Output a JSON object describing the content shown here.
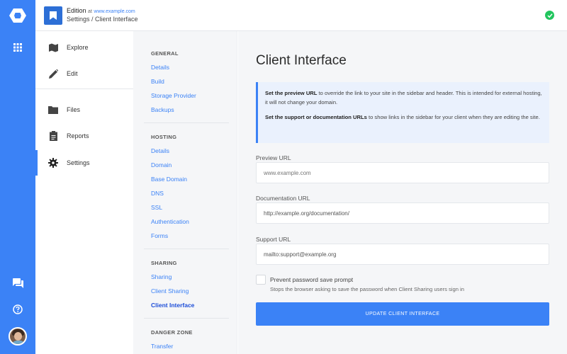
{
  "header": {
    "site_name": "Edition",
    "at_label": "at",
    "site_url": "www.example.com",
    "breadcrumb": "Settings / Client Interface",
    "status_icon": "check-circle-icon",
    "status_color": "#22c55e"
  },
  "rail": {
    "brand_color": "#3b82f6",
    "icons": [
      "logo-icon",
      "apps-grid-icon",
      "chat-icon",
      "help-icon",
      "avatar"
    ]
  },
  "nav": {
    "items": [
      {
        "label": "Explore",
        "icon": "map-icon"
      },
      {
        "label": "Edit",
        "icon": "pencil-icon"
      },
      {
        "label": "Files",
        "icon": "folder-icon"
      },
      {
        "label": "Reports",
        "icon": "clipboard-icon"
      },
      {
        "label": "Settings",
        "icon": "gear-icon",
        "active": true
      }
    ]
  },
  "subnav": {
    "sections": [
      {
        "heading": "GENERAL",
        "links": [
          "Details",
          "Build",
          "Storage Provider",
          "Backups"
        ]
      },
      {
        "heading": "HOSTING",
        "links": [
          "Details",
          "Domain",
          "Base Domain",
          "DNS",
          "SSL",
          "Authentication",
          "Forms"
        ]
      },
      {
        "heading": "SHARING",
        "links": [
          "Sharing",
          "Client Sharing",
          "Client Interface"
        ]
      },
      {
        "heading": "DANGER ZONE",
        "links": [
          "Transfer"
        ]
      }
    ],
    "active": "Client Interface"
  },
  "main": {
    "title": "Client Interface",
    "info": {
      "p1_bold": "Set the preview URL",
      "p1_text": " to override the link to your site in the sidebar and header. This is intended for external hosting, it will not change your domain.",
      "p2_bold": "Set the support or documentation URLs",
      "p2_text": " to show links in the sidebar for your client when they are editing the site."
    },
    "preview_url": {
      "label": "Preview URL",
      "value": "",
      "placeholder": "www.example.com"
    },
    "documentation_url": {
      "label": "Documentation URL",
      "value": "http://example.org/documentation/",
      "placeholder": ""
    },
    "support_url": {
      "label": "Support URL",
      "value": "mailto:support@example.org",
      "placeholder": ""
    },
    "prevent_password": {
      "label": "Prevent password save prompt",
      "help": "Stops the browser asking to save the password when Client Sharing users sign in",
      "checked": false
    },
    "update_button": "UPDATE CLIENT INTERFACE",
    "accent_color": "#3b82f6"
  }
}
